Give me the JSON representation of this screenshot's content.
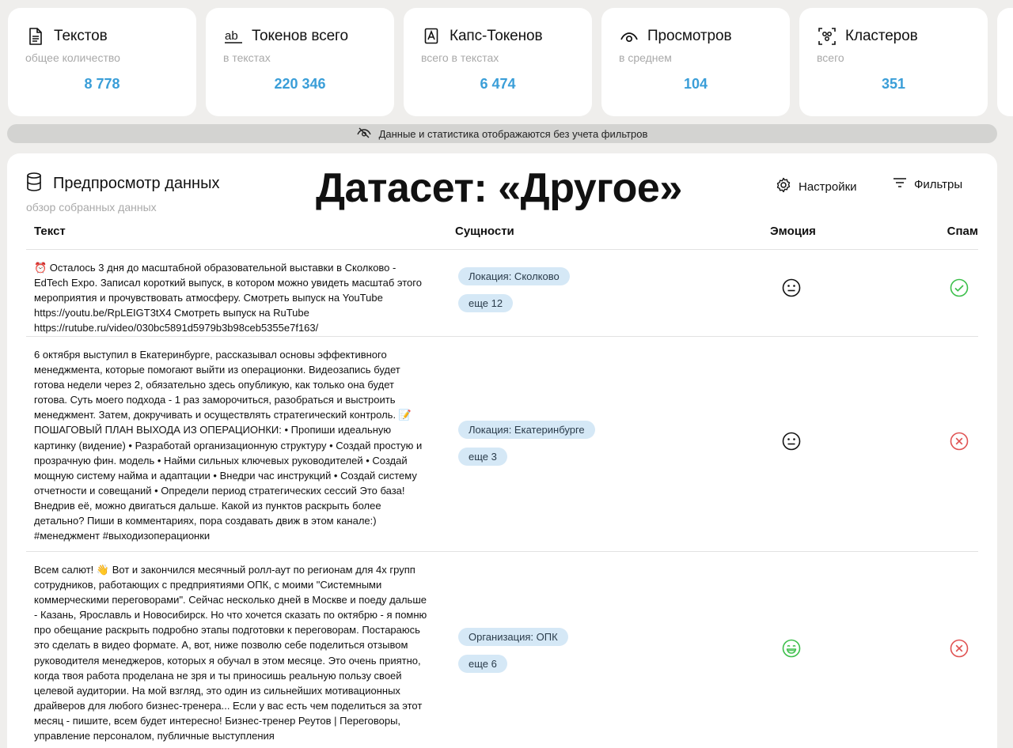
{
  "stats": [
    {
      "icon": "document-icon",
      "title": "Текстов",
      "subtitle": "общее количество",
      "value": "8 778"
    },
    {
      "icon": "ab-text-icon",
      "title": "Токенов всего",
      "subtitle": "в текстах",
      "value": "220 346"
    },
    {
      "icon": "capital-letter-icon",
      "title": "Капс-Токенов",
      "subtitle": "всего в текстах",
      "value": "6 474"
    },
    {
      "icon": "eye-icon",
      "title": "Просмотров",
      "subtitle": "в среднем",
      "value": "104"
    },
    {
      "icon": "cluster-icon",
      "title": "Кластеров",
      "subtitle": "всего",
      "value": "351"
    }
  ],
  "notice": {
    "icon": "eye-off-icon",
    "text": "Данные и статистика отображаются без учета фильтров"
  },
  "panel": {
    "icon": "database-icon",
    "title": "Предпросмотр данных",
    "subtitle": "обзор собранных данных",
    "overlay_title": "Датасет: «Другое»",
    "settings_label": "Настройки",
    "filters_label": "Фильтры"
  },
  "table": {
    "columns": {
      "text": "Текст",
      "entities": "Сущности",
      "emotion": "Эмоция",
      "spam": "Спам"
    },
    "rows": [
      {
        "text": "⏰ Осталось 3 дня до масштабной образовательной выставки в Сколково - EdTech Expo. Записал короткий выпуск, в котором можно увидеть масштаб этого мероприятия и прочувствовать атмосферу. Смотреть выпуск на YouTube https://youtu.be/RpLEIGT3tX4 Смотреть выпуск на RuTube https://rutube.ru/video/030bc5891d5979b3b98ceb5355e7f163/",
        "entity": "Локация: Сколково",
        "more": "еще 12",
        "emotion": "neutral",
        "spam": "not-spam"
      },
      {
        "text": "6 октября выступил в Екатеринбурге, рассказывал основы эффективного менеджмента, которые помогают выйти из операционки. Видеозапись будет готова недели через 2, обязательно здесь опубликую, как только она будет готова. Суть моего подхода - 1 раз заморочиться, разобраться и выстроить менеджмент. Затем, докручивать и осуществлять стратегический контроль. 📝 ПОШАГОВЫЙ ПЛАН ВЫХОДА ИЗ ОПЕРАЦИОНКИ: • Пропиши идеальную картинку (видение) • Разработай организационную структуру • Создай простую и прозрачную фин. модель • Найми сильных ключевых руководителей • Создай мощную систему найма и адаптации • Внедри час инструкций • Создай систему отчетности и совещаний • Определи период стратегических сессий Это база! Внедрив её, можно двигаться дальше. Какой из пунктов раскрыть более детально? Пиши в комментариях, пора создавать движ в этом канале:) #менеджмент #выходизоперационки",
        "entity": "Локация: Екатеринбурге",
        "more": "еще 3",
        "emotion": "neutral",
        "spam": "spam"
      },
      {
        "text": "Всем салют! 👋 Вот и закончился месячный ролл-аут по регионам для 4х групп сотрудников, работающих с предприятиями ОПК, с моими \"Системными коммерческими переговорами\". Сейчас несколько дней в Москве и поеду дальше - Казань, Ярославль и Новосибирск. Но что хочется сказать по октябрю - я помню про обещание раскрыть подробно этапы подготовки к переговорам. Постараюсь это сделать в видео формате. А, вот, ниже позволю себе поделиться отзывом руководителя менеджеров, которых я обучал в этом месяце. Это очень приятно, когда твоя работа проделана не зря и ты приносишь реальную пользу своей целевой аудитории. На мой взгляд, это один из сильнейших мотивационных драйверов для любого бизнес-тренера... Если у вас есть чем поделиться за этот месяц - пишите, всем будет интересно! Бизнес-тренер Реутов | Переговоры, управление персоналом, публичные выступления",
        "entity": "Организация: ОПК",
        "more": "еще 6",
        "emotion": "positive",
        "spam": "spam"
      }
    ]
  },
  "colors": {
    "accent_value": "#3a9ed8",
    "chip_bg": "#d5e8f6",
    "ok_green": "#3cbf4a",
    "spam_red": "#e05252"
  }
}
